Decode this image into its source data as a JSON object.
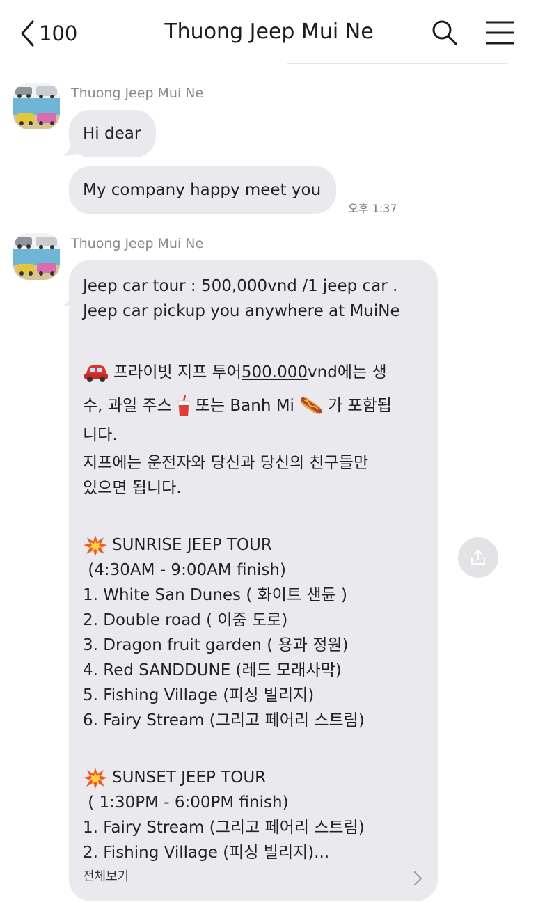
{
  "header": {
    "back_count": "100",
    "title": "Thuong Jeep Mui Ne",
    "icons": [
      "back-arrow-icon",
      "search-icon",
      "menu-icon"
    ]
  },
  "messages": {
    "group1": {
      "sender": "Thuong Jeep Mui Ne",
      "bubble1": "Hi dear",
      "bubble2": "My company happy meet you",
      "time": "오후 1:37"
    },
    "group2": {
      "sender": "Thuong Jeep Mui Ne",
      "lines": {
        "l1": "Jeep car tour : 500,000vnd /1 jeep car .",
        "l2": "Jeep car pickup you anywhere at MuiNe",
        "k1_prefix": "프라이빗 지프 투어 ",
        "k1_price": "500.000",
        "k1_suffix": "vnd에는 생",
        "k2_a": "수, 과일 주스",
        "k2_b": "또는 Banh Mi",
        "k2_c": "가 포함됩",
        "k3": "니다.",
        "k4": "    지프에는 운전자와 당신과 당신의 친구들만",
        "k5": "있으면 됩니다.",
        "sunrise_title": "SUNRISE JEEP TOUR",
        "sunrise_time": " (4:30AM - 9:00AM finish)",
        "sunrise_items": [
          "1.  White San Dunes ( 화이트 샌듄 )",
          "2. Double road ( 이중 도로)",
          "3. Dragon fruit garden ( 용과 정원)",
          "4. Red SANDDUNE (레드 모래사막)",
          "5. Fishing Village (피싱 빌리지)",
          "6. Fairy Stream (그리고 페어리 스트림)"
        ],
        "sunset_title": "SUNSET JEEP TOUR",
        "sunset_time": " ( 1:30PM - 6:00PM finish)",
        "sunset_items": [
          "1. Fairy Stream (그리고 페어리 스트림)",
          "2. Fishing Village (피싱 빌리지)..."
        ]
      },
      "view_all": "전체보기"
    }
  },
  "emoji_icons": [
    "car-emoji-icon",
    "juice-emoji-icon",
    "hotdog-emoji-icon",
    "collision-emoji-icon"
  ],
  "colors": {
    "bubble_bg": "#eaeaee",
    "header_text": "#1c1c1c",
    "meta_text": "#8a8a8a"
  }
}
